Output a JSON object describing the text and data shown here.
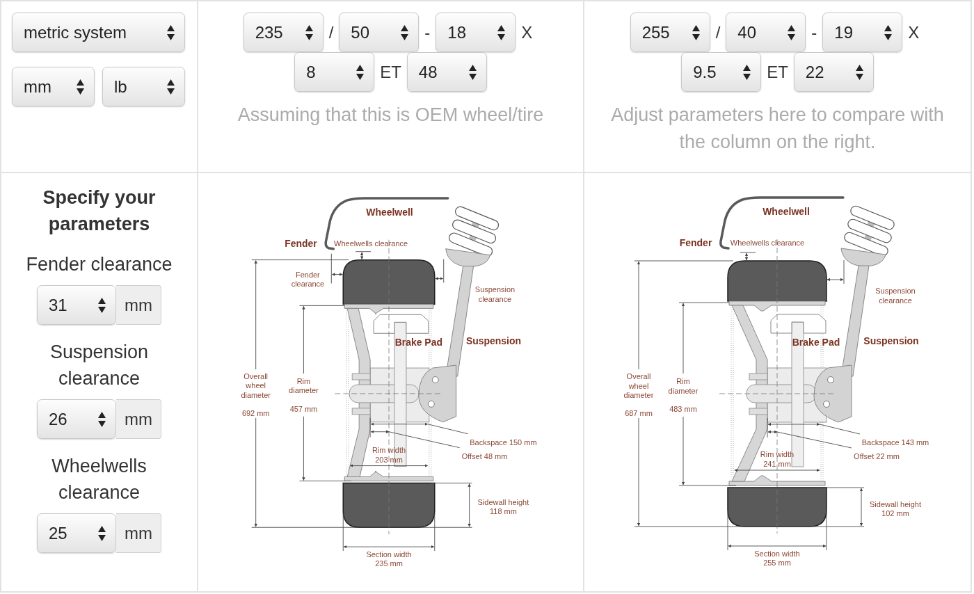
{
  "units": {
    "system": "metric system",
    "length": "mm",
    "weight": "lb"
  },
  "parameters": {
    "title": "Specify your parameters",
    "fields": [
      {
        "label": "Fender clearance",
        "value": "31",
        "unit": "mm"
      },
      {
        "label": "Suspension clearance",
        "value": "26",
        "unit": "mm"
      },
      {
        "label": "Wheelwells clearance",
        "value": "25",
        "unit": "mm"
      }
    ]
  },
  "setups": [
    {
      "size_rows": [
        [
          {
            "kind": "select",
            "text": "235"
          },
          {
            "kind": "separator",
            "text": "/"
          },
          {
            "kind": "select",
            "text": "50"
          },
          {
            "kind": "separator",
            "text": "-"
          },
          {
            "kind": "select",
            "text": "18"
          },
          {
            "kind": "separator",
            "text": "X"
          }
        ],
        [
          {
            "kind": "select",
            "text": "8"
          },
          {
            "kind": "separator",
            "text": "ET"
          },
          {
            "kind": "select",
            "text": "48"
          }
        ]
      ],
      "note": "Assuming that this is OEM wheel/tire",
      "diagram": {
        "wheelwell": "Wheelwell",
        "fender": "Fender",
        "wheelwells_clearance": "Wheelwells clearance",
        "fender_clearance": [
          "Fender",
          "clearance"
        ],
        "suspension_clearance": [
          "Suspension",
          "clearance"
        ],
        "brake_pad": "Brake Pad",
        "suspension": "Suspension",
        "overall_wheel_diameter": {
          "label": [
            "Overall",
            "wheel",
            "diameter"
          ],
          "value": "692 mm"
        },
        "rim_diameter": {
          "label": [
            "Rim",
            "diameter"
          ],
          "value": "457 mm"
        },
        "backspace": "Backspace 150 mm",
        "offset": "Offset 48 mm",
        "rim_width": {
          "label": "Rim width",
          "value": "203 mm"
        },
        "sidewall_height": {
          "label": "Sidewall height",
          "value": "118 mm"
        },
        "section_width": {
          "label": "Section width",
          "value": "235 mm"
        }
      }
    },
    {
      "size_rows": [
        [
          {
            "kind": "select",
            "text": "255"
          },
          {
            "kind": "separator",
            "text": "/"
          },
          {
            "kind": "select",
            "text": "40"
          },
          {
            "kind": "separator",
            "text": "-"
          },
          {
            "kind": "select",
            "text": "19"
          },
          {
            "kind": "separator",
            "text": "X"
          }
        ],
        [
          {
            "kind": "select",
            "text": "9.5"
          },
          {
            "kind": "separator",
            "text": "ET"
          },
          {
            "kind": "select",
            "text": "22"
          }
        ]
      ],
      "note": "Adjust parameters here to compare with the column on the right.",
      "diagram": {
        "wheelwell": "Wheelwell",
        "fender": "Fender",
        "wheelwells_clearance": "Wheelwells clearance",
        "suspension_clearance": [
          "Suspension",
          "clearance"
        ],
        "brake_pad": "Brake Pad",
        "suspension": "Suspension",
        "overall_wheel_diameter": {
          "label": [
            "Overall",
            "wheel",
            "diameter"
          ],
          "value": "687 mm"
        },
        "rim_diameter": {
          "label": [
            "Rim",
            "diameter"
          ],
          "value": "483 mm"
        },
        "backspace": "Backspace 143 mm",
        "offset": "Offset 22 mm",
        "rim_width": {
          "label": "Rim width",
          "value": "241 mm"
        },
        "sidewall_height": {
          "label": "Sidewall height",
          "value": "102 mm"
        },
        "section_width": {
          "label": "Section width",
          "value": "255 mm"
        }
      }
    }
  ]
}
